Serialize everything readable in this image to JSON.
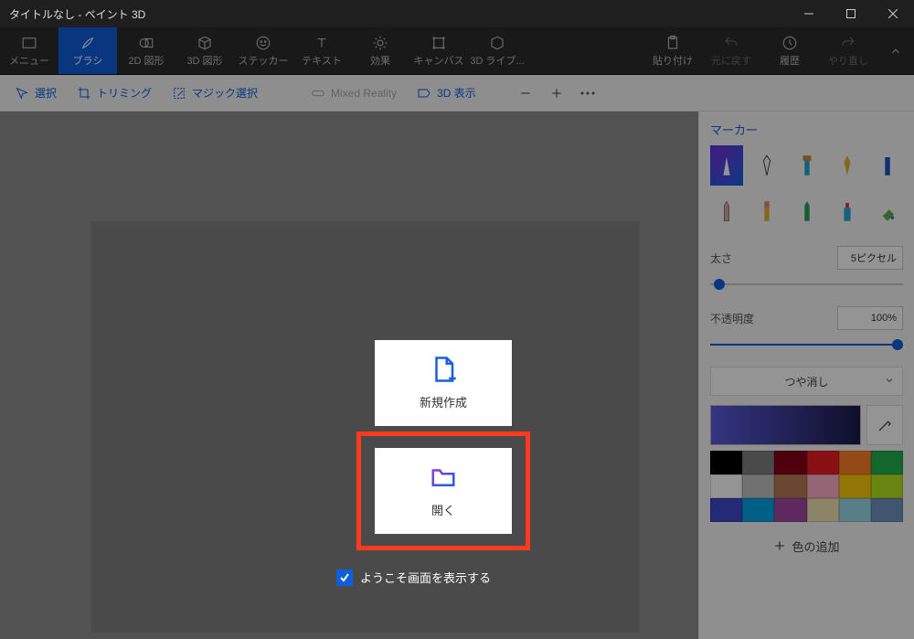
{
  "window": {
    "title": "タイトルなし - ペイント 3D"
  },
  "ribbon": {
    "menu": "メニュー",
    "brushes": "ブラシ",
    "shapes2d": "2D 図形",
    "shapes3d": "3D 図形",
    "stickers": "ステッカー",
    "text": "テキスト",
    "effects": "効果",
    "canvas": "キャンバス",
    "library3d": "3D ライブ...",
    "paste": "貼り付け",
    "undo": "元に戻す",
    "history": "履歴",
    "redo": "やり直し"
  },
  "toolbar": {
    "select": "選択",
    "crop": "トリミング",
    "magic": "マジック選択",
    "mr": "Mixed Reality",
    "view3d": "3D 表示"
  },
  "side": {
    "heading": "マーカー",
    "thickness_label": "太さ",
    "thickness_value": "5ピクセル",
    "opacity_label": "不透明度",
    "opacity_value": "100%",
    "finish": "つや消し",
    "add_color": "色の追加"
  },
  "welcome": {
    "new": "新規作成",
    "open": "開く",
    "show_welcome": "ようこそ画面を表示する"
  },
  "palette_colors": [
    "#000000",
    "#7f7f7f",
    "#870014",
    "#ed1c24",
    "#ff7f27",
    "#22b14c",
    "#ffffff",
    "#c3c3c3",
    "#b97a57",
    "#ffaec9",
    "#ffc90e",
    "#b5e61d",
    "#3f48cc",
    "#00a2e8",
    "#a349a4",
    "#efe4b0",
    "#99d9ea",
    "#7092be"
  ]
}
